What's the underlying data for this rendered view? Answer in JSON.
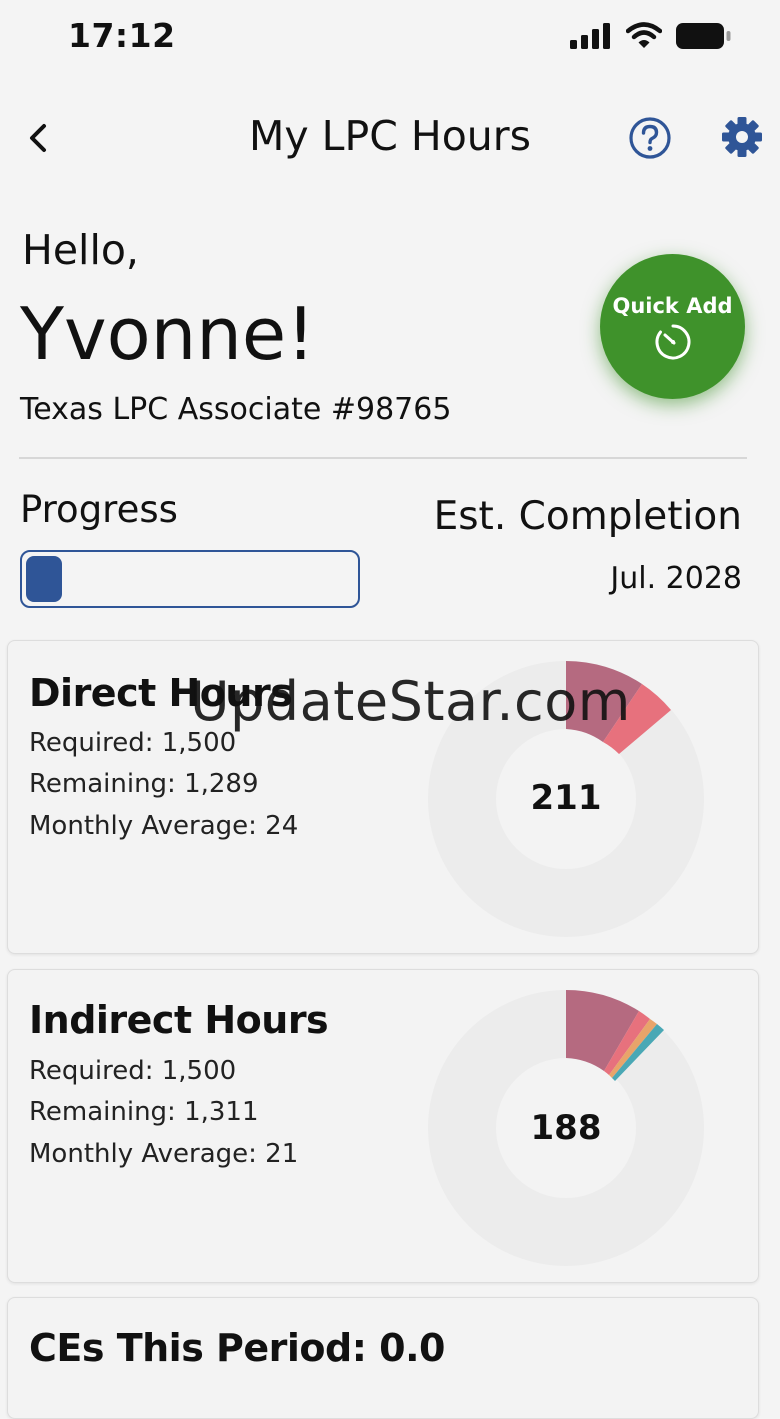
{
  "status_bar": {
    "time": "17:12"
  },
  "header": {
    "title": "My LPC Hours"
  },
  "greeting": {
    "hello": "Hello,",
    "name": "Yvonne!",
    "license": "Texas LPC Associate #98765"
  },
  "quick_add": {
    "label": "Quick Add"
  },
  "progress": {
    "label": "Progress",
    "fraction": 0.11,
    "est_label": "Est. Completion",
    "est_date": "Jul. 2028"
  },
  "cards": {
    "direct": {
      "title": "Direct Hours",
      "required": "Required: 1,500",
      "remaining": "Remaining: 1,289",
      "monthly": "Monthly Average: 24",
      "total": "211"
    },
    "indirect": {
      "title": "Indirect Hours",
      "required": "Required: 1,500",
      "remaining": "Remaining: 1,311",
      "monthly": "Monthly Average: 21",
      "total": "188"
    },
    "ces": {
      "title": "CEs This Period: 0.0"
    }
  },
  "watermark": "UpdateStar.com",
  "colors": {
    "accent": "#2f5597",
    "quick_add": "#3f922b",
    "segment_primary": "#b56a80",
    "segment_secondary": "#e7717d",
    "segment_teal": "#4aa8b5",
    "segment_orange": "#e8a46a",
    "donut_track": "#ececec"
  }
}
